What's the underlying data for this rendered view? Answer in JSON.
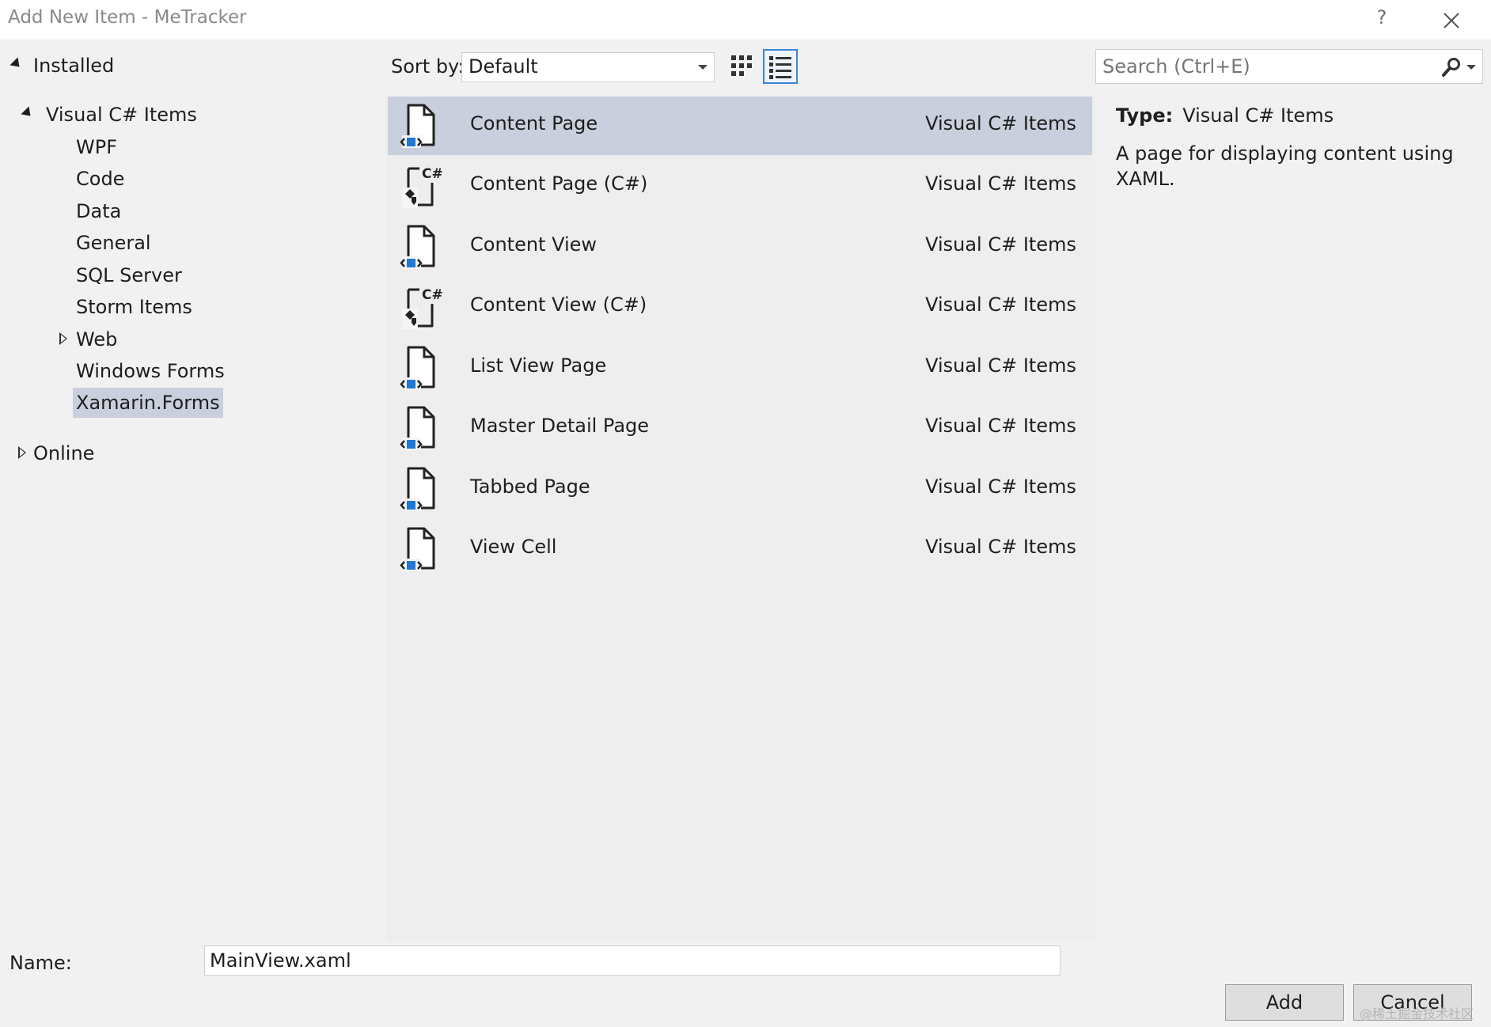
{
  "window": {
    "title": "Add New Item - MeTracker",
    "help_label": "?"
  },
  "tree": {
    "installed": "Installed",
    "visual_csharp": "Visual C# Items",
    "children": [
      "WPF",
      "Code",
      "Data",
      "General",
      "SQL Server",
      "Storm Items",
      "Web",
      "Windows Forms",
      "Xamarin.Forms"
    ],
    "selected": "Xamarin.Forms",
    "online": "Online"
  },
  "toolbar": {
    "sort_label": "Sort by:",
    "sort_value": "Default"
  },
  "search": {
    "placeholder": "Search (Ctrl+E)"
  },
  "templates": [
    {
      "name": "Content Page",
      "type": "Visual C# Items",
      "icon": "xaml-page-icon"
    },
    {
      "name": "Content Page (C#)",
      "type": "Visual C# Items",
      "icon": "csharp-page-icon"
    },
    {
      "name": "Content View",
      "type": "Visual C# Items",
      "icon": "xaml-page-icon"
    },
    {
      "name": "Content View (C#)",
      "type": "Visual C# Items",
      "icon": "csharp-page-icon"
    },
    {
      "name": "List View Page",
      "type": "Visual C# Items",
      "icon": "xaml-page-icon"
    },
    {
      "name": "Master Detail Page",
      "type": "Visual C# Items",
      "icon": "xaml-page-icon"
    },
    {
      "name": "Tabbed Page",
      "type": "Visual C# Items",
      "icon": "xaml-page-icon"
    },
    {
      "name": "View Cell",
      "type": "Visual C# Items",
      "icon": "xaml-page-icon"
    }
  ],
  "details": {
    "type_label": "Type:",
    "type_value": "Visual C# Items",
    "description": "A page for displaying content using XAML."
  },
  "name_field": {
    "label": "Name:",
    "value": "MainView.xaml"
  },
  "buttons": {
    "add": "Add",
    "cancel": "Cancel"
  },
  "watermark": "@稀土掘金技术社区",
  "colors": {
    "selection": "#c9cfdc",
    "accent": "#3b86d6",
    "icon_blue": "#1e78d4"
  }
}
